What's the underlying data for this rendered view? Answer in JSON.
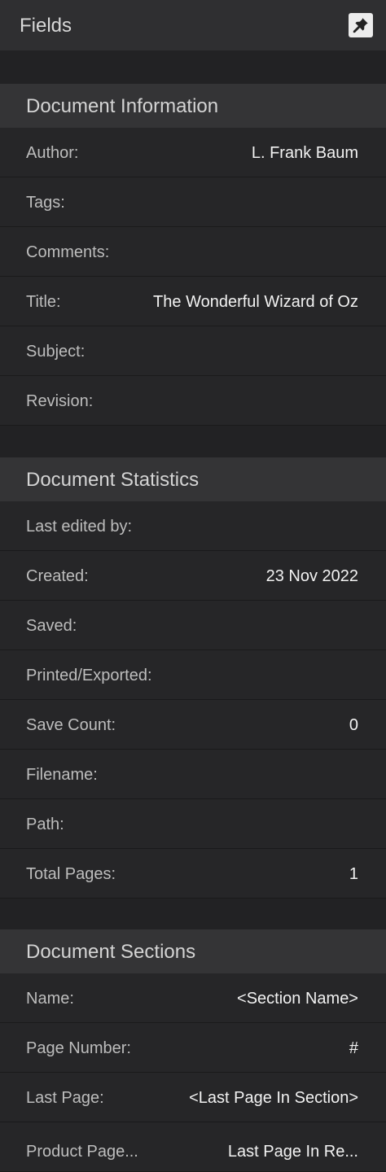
{
  "panel": {
    "title": "Fields",
    "pin_icon": "pin-icon"
  },
  "document_information": {
    "title": "Document Information",
    "rows": [
      {
        "label": "Author:",
        "value": "L. Frank Baum"
      },
      {
        "label": "Tags:",
        "value": ""
      },
      {
        "label": "Comments:",
        "value": ""
      },
      {
        "label": "Title:",
        "value": "The Wonderful Wizard of Oz"
      },
      {
        "label": "Subject:",
        "value": ""
      },
      {
        "label": "Revision:",
        "value": ""
      }
    ]
  },
  "document_statistics": {
    "title": "Document Statistics",
    "rows": [
      {
        "label": "Last edited by:",
        "value": ""
      },
      {
        "label": "Created:",
        "value": "23 Nov 2022"
      },
      {
        "label": "Saved:",
        "value": ""
      },
      {
        "label": "Printed/Exported:",
        "value": ""
      },
      {
        "label": "Save Count:",
        "value": "0"
      },
      {
        "label": "Filename:",
        "value": ""
      },
      {
        "label": "Path:",
        "value": ""
      },
      {
        "label": "Total Pages:",
        "value": "1"
      }
    ]
  },
  "document_sections": {
    "title": "Document Sections",
    "rows": [
      {
        "label": "Name:",
        "value": "<Section Name>"
      },
      {
        "label": "Page Number:",
        "value": "#"
      },
      {
        "label": "Last Page:",
        "value": "<Last Page In Section>"
      },
      {
        "label": "Product Page...",
        "value": "Last Page In Re..."
      }
    ]
  },
  "colors": {
    "background": "#222224",
    "header": "#2f2f31",
    "section_header": "#343436",
    "row": "#262628"
  }
}
